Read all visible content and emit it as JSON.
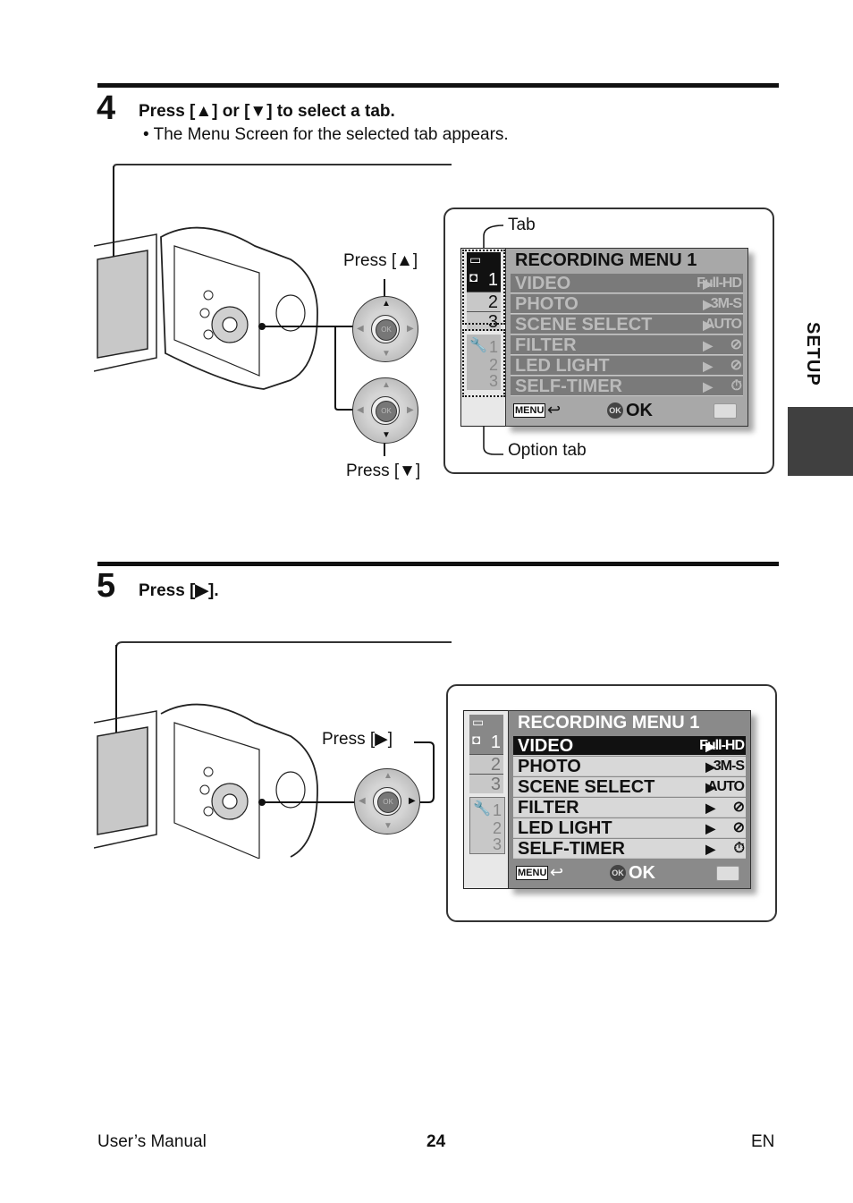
{
  "step4": {
    "number": "4",
    "title": "Press [▲] or [▼] to select a tab.",
    "bullet": "•  The Menu Screen for the selected tab appears.",
    "labels": {
      "press_up": "Press [▲]",
      "press_down": "Press [▼]",
      "tab": "Tab",
      "option_tab": "Option tab"
    },
    "screen": {
      "title": "RECORDING MENU 1",
      "rows": [
        {
          "label": "VIDEO",
          "value": "Full-HD"
        },
        {
          "label": "PHOTO",
          "value": "3M-S"
        },
        {
          "label": "SCENE SELECT",
          "value": "AUTO"
        },
        {
          "label": "FILTER",
          "value": "filter-off-icon"
        },
        {
          "label": "LED LIGHT",
          "value": "led-off-icon"
        },
        {
          "label": "SELF-TIMER",
          "value": "timer-off-icon"
        }
      ],
      "record_tabs": [
        "1",
        "2",
        "3"
      ],
      "option_tabs": [
        "1",
        "2",
        "3"
      ],
      "selected_row": null,
      "active_tab": "record-1",
      "menu_key": "MENU",
      "ok_key": "OK",
      "ok_label": "OK"
    }
  },
  "step5": {
    "number": "5",
    "title": "Press [▶].",
    "labels": {
      "press_right": "Press [▶]"
    },
    "screen": {
      "title": "RECORDING MENU 1",
      "rows": [
        {
          "label": "VIDEO",
          "value": "Full-HD"
        },
        {
          "label": "PHOTO",
          "value": "3M-S"
        },
        {
          "label": "SCENE SELECT",
          "value": "AUTO"
        },
        {
          "label": "FILTER",
          "value": "filter-off-icon"
        },
        {
          "label": "LED LIGHT",
          "value": "led-off-icon"
        },
        {
          "label": "SELF-TIMER",
          "value": "timer-off-icon"
        }
      ],
      "record_tabs": [
        "1",
        "2",
        "3"
      ],
      "option_tabs": [
        "1",
        "2",
        "3"
      ],
      "selected_row": "VIDEO",
      "menu_key": "MENU",
      "ok_key": "OK",
      "ok_label": "OK"
    }
  },
  "side_tab": "SETUP",
  "footer": {
    "left": "User’s Manual",
    "page": "24",
    "right": "EN"
  },
  "colors": {
    "side_tab_block": "#404040",
    "menu_panel": "#8a8a8a",
    "selected_row": "#111111"
  }
}
